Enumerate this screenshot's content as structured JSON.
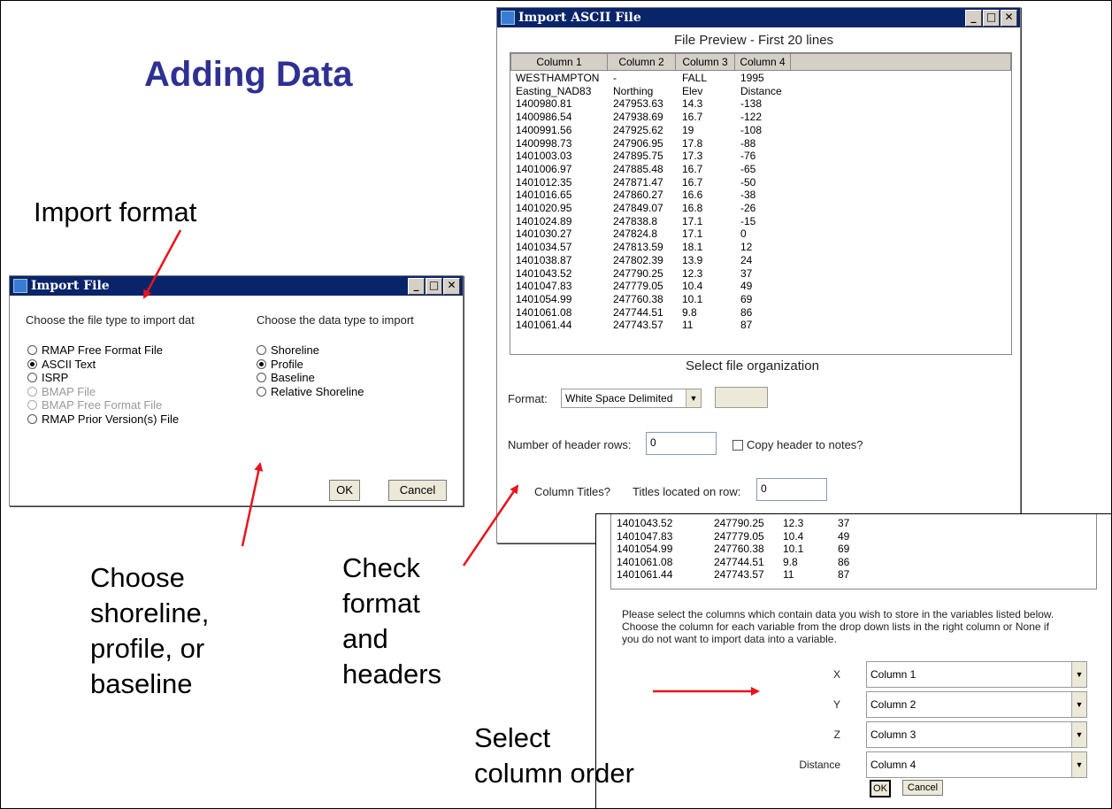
{
  "slide": {
    "title": "Adding Data",
    "note_import_format": "Import format",
    "note_choose": [
      "Choose",
      "shoreline,",
      "profile, or",
      "baseline"
    ],
    "note_check": [
      "Check",
      "format",
      "and",
      "headers"
    ],
    "note_select": [
      "Select",
      "column order"
    ]
  },
  "import_file": {
    "title": "Import File",
    "file_type_label": "Choose the file type to import dat",
    "data_type_label": "Choose the data type to import",
    "file_types": [
      {
        "label": "RMAP Free Format File",
        "selected": false,
        "disabled": false
      },
      {
        "label": "ASCII Text",
        "selected": true,
        "disabled": false
      },
      {
        "label": "ISRP",
        "selected": false,
        "disabled": false
      },
      {
        "label": "BMAP File",
        "selected": false,
        "disabled": true
      },
      {
        "label": "BMAP Free Format File",
        "selected": false,
        "disabled": true
      },
      {
        "label": "RMAP Prior Version(s) File",
        "selected": false,
        "disabled": false
      }
    ],
    "data_types": [
      {
        "label": "Shoreline",
        "selected": false
      },
      {
        "label": "Profile",
        "selected": true
      },
      {
        "label": "Baseline",
        "selected": false
      },
      {
        "label": "Relative Shoreline",
        "selected": false
      }
    ],
    "ok": "OK",
    "cancel": "Cancel"
  },
  "import_ascii": {
    "title": "Import ASCII File",
    "preview_title": "File Preview - First 20 lines",
    "columns": [
      "Column 1",
      "Column 2",
      "Column 3",
      "Column 4"
    ],
    "rows": [
      [
        "WESTHAMPTON",
        "-",
        "FALL",
        "1995"
      ],
      [
        "Easting_NAD83",
        "Northing",
        "Elev",
        "Distance"
      ],
      [
        "1400980.81",
        "247953.63",
        "14.3",
        "-138"
      ],
      [
        "1400986.54",
        "247938.69",
        "16.7",
        "-122"
      ],
      [
        "1400991.56",
        "247925.62",
        "19",
        "-108"
      ],
      [
        "1400998.73",
        "247906.95",
        "17.8",
        "-88"
      ],
      [
        "1401003.03",
        "247895.75",
        "17.3",
        "-76"
      ],
      [
        "1401006.97",
        "247885.48",
        "16.7",
        "-65"
      ],
      [
        "1401012.35",
        "247871.47",
        "16.7",
        "-50"
      ],
      [
        "1401016.65",
        "247860.27",
        "16.6",
        "-38"
      ],
      [
        "1401020.95",
        "247849.07",
        "16.8",
        "-26"
      ],
      [
        "1401024.89",
        "247838.8",
        "17.1",
        "-15"
      ],
      [
        "1401030.27",
        "247824.8",
        "17.1",
        "0"
      ],
      [
        "1401034.57",
        "247813.59",
        "18.1",
        "12"
      ],
      [
        "1401038.87",
        "247802.39",
        "13.9",
        "24"
      ],
      [
        "1401043.52",
        "247790.25",
        "12.3",
        "37"
      ],
      [
        "1401047.83",
        "247779.05",
        "10.4",
        "49"
      ],
      [
        "1401054.99",
        "247760.38",
        "10.1",
        "69"
      ],
      [
        "1401061.08",
        "247744.51",
        "9.8",
        "86"
      ],
      [
        "1401061.44",
        "247743.57",
        "11",
        "87"
      ]
    ],
    "org_title": "Select file organization",
    "format_label": "Format:",
    "format_value": "White Space Delimited",
    "header_rows_label": "Number of header rows:",
    "header_rows_value": "0",
    "copy_header_label": "Copy header to notes?",
    "column_titles_label": "Column Titles?",
    "titles_row_label": "Titles located on row:",
    "titles_row_value": "0"
  },
  "column_select": {
    "rows": [
      [
        "1401043.52",
        "247790.25",
        "12.3",
        "37"
      ],
      [
        "1401047.83",
        "247779.05",
        "10.4",
        "49"
      ],
      [
        "1401054.99",
        "247760.38",
        "10.1",
        "69"
      ],
      [
        "1401061.08",
        "247744.51",
        "9.8",
        "86"
      ],
      [
        "1401061.44",
        "247743.57",
        "11",
        "87"
      ]
    ],
    "instructions": [
      "Please select the columns which contain data you wish to store in the variables listed below.",
      "Choose the column for each variable from the drop down lists in the right column or None if",
      "you do not want to import data into a variable."
    ],
    "variables": [
      {
        "label": "X",
        "value": "Column 1"
      },
      {
        "label": "Y",
        "value": "Column 2"
      },
      {
        "label": "Z",
        "value": "Column 3"
      },
      {
        "label": "Distance",
        "value": "Column 4"
      }
    ],
    "ok": "OK",
    "cancel": "Cancel"
  },
  "colors": {
    "title": "#2e3192",
    "arrow": "#e8141b",
    "titlebar": "#0a246a"
  }
}
